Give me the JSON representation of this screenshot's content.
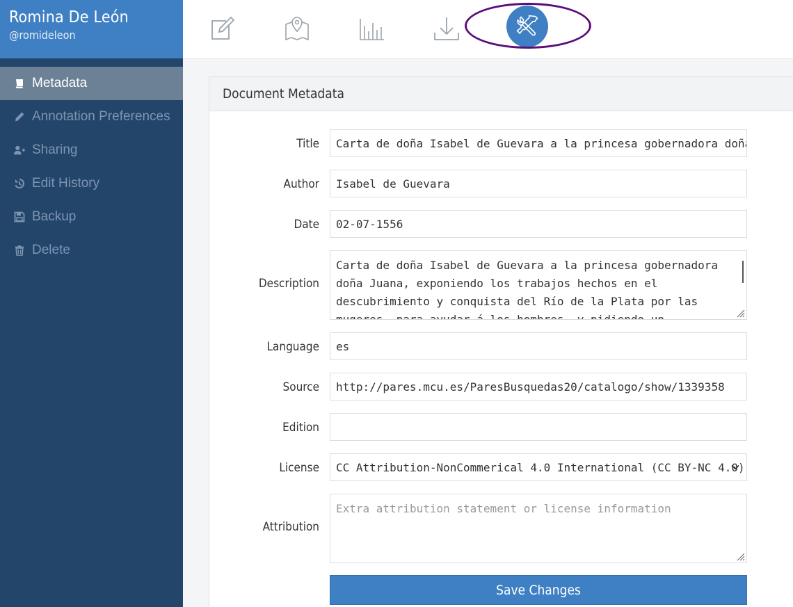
{
  "user": {
    "name": "Romina De León",
    "handle": "@romideleon"
  },
  "sidebar": {
    "items": [
      {
        "label": "Metadata",
        "icon": "book-icon",
        "active": true
      },
      {
        "label": "Annotation Preferences",
        "icon": "pencil-icon",
        "active": false
      },
      {
        "label": "Sharing",
        "icon": "user-plus-icon",
        "active": false
      },
      {
        "label": "Edit History",
        "icon": "history-icon",
        "active": false
      },
      {
        "label": "Backup",
        "icon": "floppy-disk-icon",
        "active": false
      },
      {
        "label": "Delete",
        "icon": "trash-icon",
        "active": false
      }
    ]
  },
  "toolbar": {
    "tools": [
      {
        "icon": "edit-icon",
        "active": false
      },
      {
        "icon": "map-icon",
        "active": false
      },
      {
        "icon": "bar-chart-icon",
        "active": false
      },
      {
        "icon": "download-icon",
        "active": false
      },
      {
        "icon": "tools-icon",
        "active": true
      }
    ],
    "accent": "#3f80c4",
    "highlight_color": "#5b0f7b"
  },
  "panel": {
    "title": "Document Metadata",
    "fields": {
      "title": {
        "label": "Title",
        "value": "Carta de doña Isabel de Guevara a la princesa gobernadora doña Juana"
      },
      "author": {
        "label": "Author",
        "value": "Isabel de Guevara"
      },
      "date": {
        "label": "Date",
        "value": "02-07-1556"
      },
      "description": {
        "label": "Description",
        "value": "Carta de doña Isabel de Guevara a la princesa gobernadora doña Juana, exponiendo los trabajos hechos en el descubrimiento y conquista del Río de la Plata por las mugeres, para ayudar á los hombres, y pidiendo un repartimiento para su marido"
      },
      "language": {
        "label": "Language",
        "value": "es"
      },
      "source": {
        "label": "Source",
        "value": "http://pares.mcu.es/ParesBusquedas20/catalogo/show/1339358"
      },
      "edition": {
        "label": "Edition",
        "value": ""
      },
      "license": {
        "label": "License",
        "value": "CC Attribution-NonCommerical 4.0 International (CC BY-NC 4.0)"
      },
      "attribution": {
        "label": "Attribution",
        "placeholder": "Extra attribution statement or license information"
      }
    },
    "save_label": "Save Changes"
  }
}
